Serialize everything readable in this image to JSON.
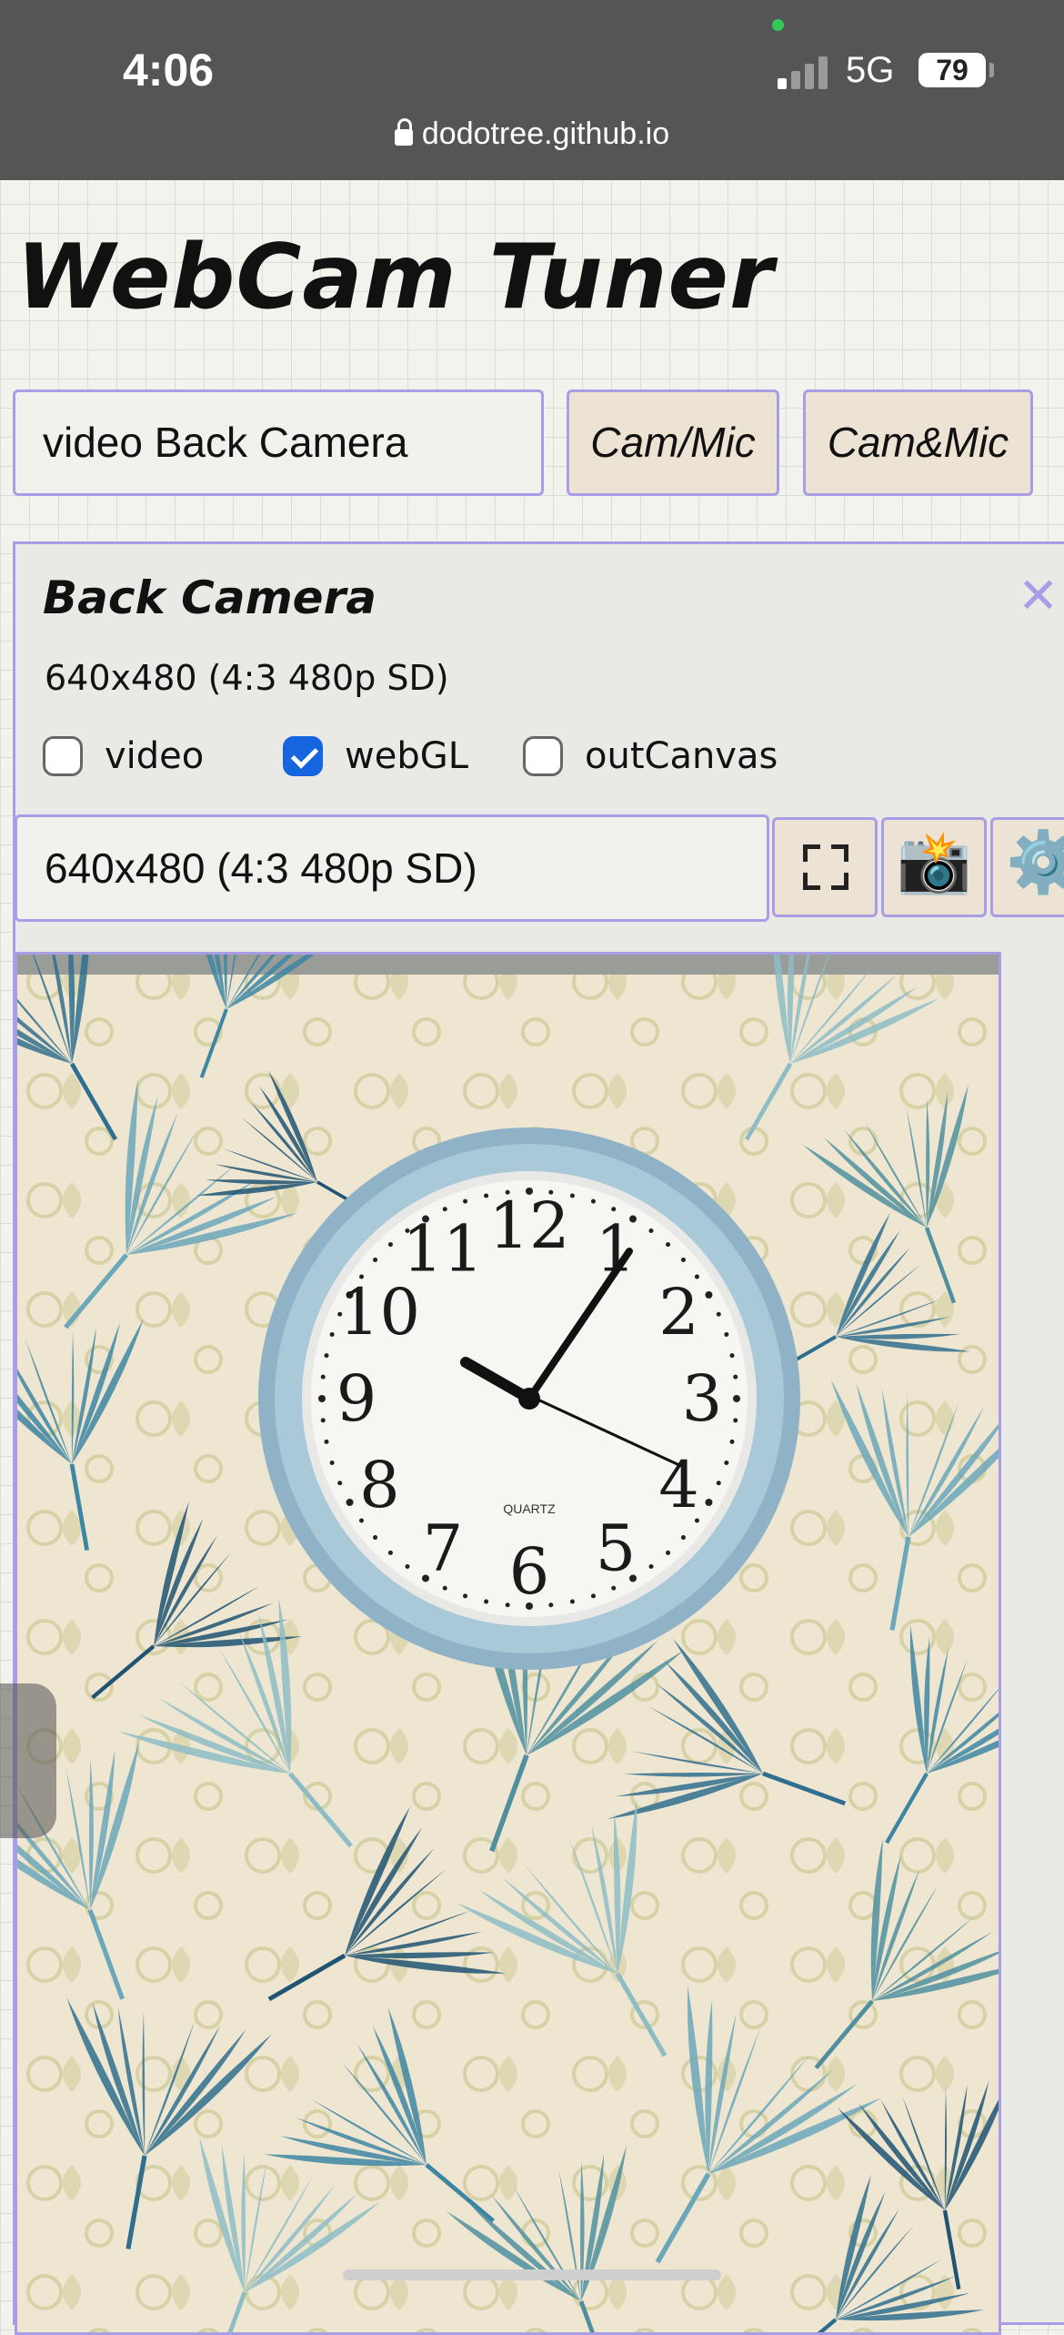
{
  "status_bar": {
    "time": "4:06",
    "network": "5G",
    "battery": "79",
    "url": "dodotree.github.io"
  },
  "page": {
    "title": "WebCam Tuner",
    "device_select_value": "video Back Camera",
    "cam_mic_button": "Cam/Mic",
    "cam_and_mic_button": "Cam&Mic"
  },
  "panel": {
    "title": "Back Camera",
    "close_label": "✕",
    "resolution_text": "640x480 (4:3 480p SD)",
    "checkboxes": [
      {
        "label": "video",
        "checked": false
      },
      {
        "label": "webGL",
        "checked": true
      },
      {
        "label": "outCanvas",
        "checked": false
      }
    ],
    "resolution_select_value": "640x480 (4:3 480p SD)",
    "snapshot_icon": "📸",
    "settings_icon": "⚙️"
  },
  "clock": {
    "numbers": [
      "12",
      "1",
      "2",
      "3",
      "4",
      "5",
      "6",
      "7",
      "8",
      "9",
      "10",
      "11"
    ],
    "brand": "QUARTZ"
  },
  "colors": {
    "accent_border": "#a99ee6",
    "button_bg": "#ece3d4",
    "status_bar_bg": "#555555",
    "checkbox_checked": "#1565e0"
  }
}
